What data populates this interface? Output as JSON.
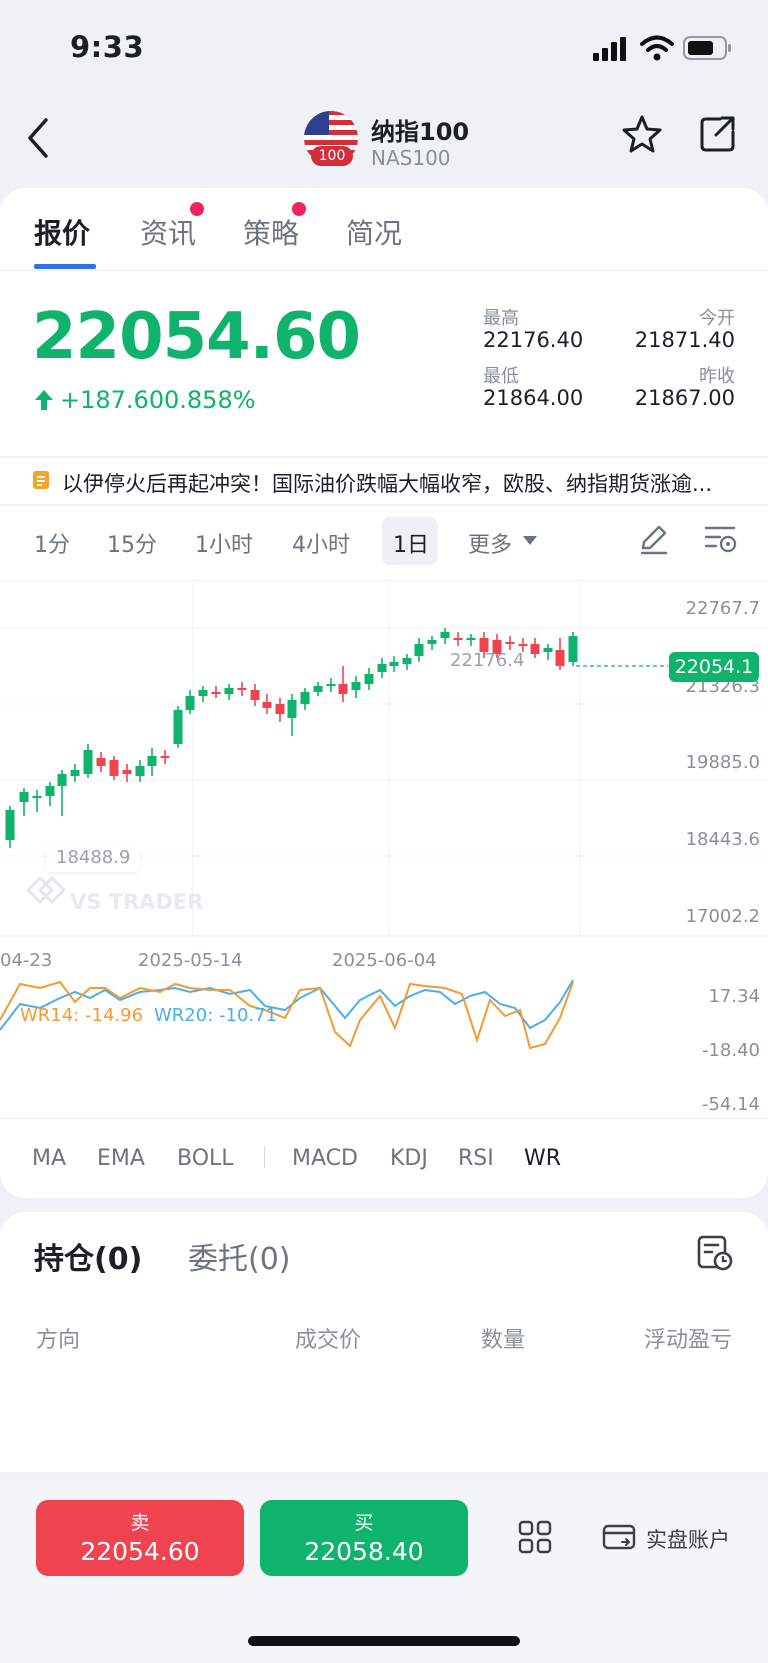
{
  "status_bar": {
    "time": "9:33"
  },
  "header": {
    "title": "纳指100",
    "symbol": "NAS100",
    "flag_badge": "100"
  },
  "tabs": [
    {
      "label": "报价",
      "active": true,
      "dot": false
    },
    {
      "label": "资讯",
      "active": false,
      "dot": true
    },
    {
      "label": "策略",
      "active": false,
      "dot": true
    },
    {
      "label": "简况",
      "active": false,
      "dot": false
    }
  ],
  "quote": {
    "price": "22054.60",
    "change": "+187.60",
    "change_pct": "0.858%",
    "high_label": "最高",
    "high": "22176.40",
    "open_label": "今开",
    "open": "21871.40",
    "low_label": "最低",
    "low": "21864.00",
    "prev_label": "昨收",
    "prev_close": "21867.00"
  },
  "news": {
    "text": "以伊停火后再起冲突！国际油价跌幅大幅收窄，欧股、纳指期货涨逾..."
  },
  "timeframes": [
    "1分",
    "15分",
    "1小时",
    "4小时",
    "1日",
    "更多"
  ],
  "chart": {
    "y_ticks": [
      "22767.7",
      "21326.3",
      "19885.0",
      "18443.6",
      "17002.2"
    ],
    "x_ticks": [
      "04-23",
      "2025-05-14",
      "2025-06-04"
    ],
    "high_marker": "22176.4",
    "low_marker": "18488.9",
    "current_price_tag": "22054.1",
    "watermark": "VS TRADER",
    "wr_label_1": "WR14: -14.96",
    "wr_label_2": "WR20: -10.71",
    "wr_ticks": [
      "17.34",
      "-18.40",
      "-54.14"
    ],
    "colors": {
      "up": "#0fb36b",
      "down": "#ef4450",
      "wr14": "#f39a33",
      "wr20": "#4aaee8"
    }
  },
  "indicators": [
    "MA",
    "EMA",
    "BOLL",
    "MACD",
    "KDJ",
    "RSI",
    "WR"
  ],
  "positions": {
    "holdings_tab": "持仓(0)",
    "orders_tab": "委托(0)",
    "columns": [
      "方向",
      "成交价",
      "数量",
      "浮动盈亏"
    ]
  },
  "trade": {
    "sell_label": "卖",
    "sell_price": "22054.60",
    "buy_label": "买",
    "buy_price": "22058.40",
    "account_label": "实盘账户"
  }
}
